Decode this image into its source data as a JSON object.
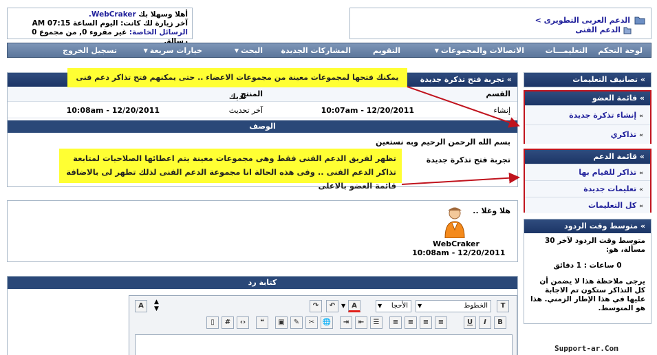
{
  "breadcrumb": {
    "root": "الدعم العربى التطويرى",
    "sep": ">",
    "current": "الدعم الفنى"
  },
  "welcome": {
    "line1_prefix": "أهلا وسهلا بك",
    "username": "WebCraker.",
    "line2": "آخر زيارة لك كانت: اليوم الساعة 07:15 AM",
    "pm_label": "الرسائل الخاصة:",
    "pm_text": "غير مقروء 0, من مجموع 0 رسالة."
  },
  "nav": [
    {
      "label": "لوحة التحكم",
      "caret": false
    },
    {
      "label": "التعليمـــات",
      "caret": false
    },
    {
      "label": "الاتصالات والمجموعات",
      "caret": true
    },
    {
      "label": "التقويم",
      "caret": false
    },
    {
      "label": "المشاركات الجديدة",
      "caret": false
    },
    {
      "label": "البحث",
      "caret": true
    },
    {
      "label": "خيارات سريعة",
      "caret": true
    },
    {
      "label": "تسجيل الخروج",
      "caret": false
    }
  ],
  "ticket": {
    "title": "» تجربة فتح تذكرة جديدة",
    "section_label": "القسم",
    "product_label": "المنتج",
    "created_label": "إنشاء",
    "created_value": "10:07am - 12/20/2011",
    "updated_label": "آخر تحديث",
    "updated_value": "10:08am - 12/20/2011",
    "desc_header": "الوصف",
    "bismillah": "بسم الله الرحمن الرحيم وبه نستعين",
    "body": "تجربة فتح تذكرة جديدة"
  },
  "post": {
    "author": "WebCraker",
    "date": "10:08am - 12/20/2011",
    "text": "هلا وغلا .."
  },
  "reply": {
    "title": "كتابة رد",
    "font_select": "الخطوط",
    "size_select": "الأحجا"
  },
  "sidebar": {
    "categories_title": "» تصانيف التعليمات",
    "member_menu_title": "» قائمة العضو",
    "member_items": [
      "إنشاء تذكرة جديدة",
      "تذاكري"
    ],
    "support_menu_title": "» قائمة الدعم",
    "support_items": [
      "تذاكر للقيام بها",
      "تعليمات جديدة",
      "كل التعليمات"
    ],
    "avg_title": "» متوسط وقت الردود",
    "avg_line1": "متوسط وقت الردود لآخر 30 مسألة، هو:",
    "avg_value": "0 ساعات : 1 دقائق",
    "avg_note": "يرجى ملاحظة هذا لا يضمن أن كل التذاكر ستكون تم الاجابة عليها في هذا الإطار الزمني. هذا هو المتوسط."
  },
  "annotations": {
    "note1": "يمكنك فتحها لمجموعات معينة من مجموعات الاعضاء .. حتى يمكنهم فتح تذاكر دعم فنى لديك",
    "note2": "تظهر لفريق الدعم الفنى فقط وهى مجموعات معينة يتم اعطائها الصلاحيات لمتابعة تذاكر الدعم الفنى .. وفى هذه الحالة انا مجموعة الدعم الفنى لذلك تظهر لى بالاضافة قائمة العضو بالاعلى"
  },
  "watermark": "Support-ar.Com",
  "colors": {
    "header_blue": "#1c3566",
    "link_blue": "#22229c",
    "annotation_yellow": "#ffff33",
    "annotation_red": "#c0141e"
  }
}
